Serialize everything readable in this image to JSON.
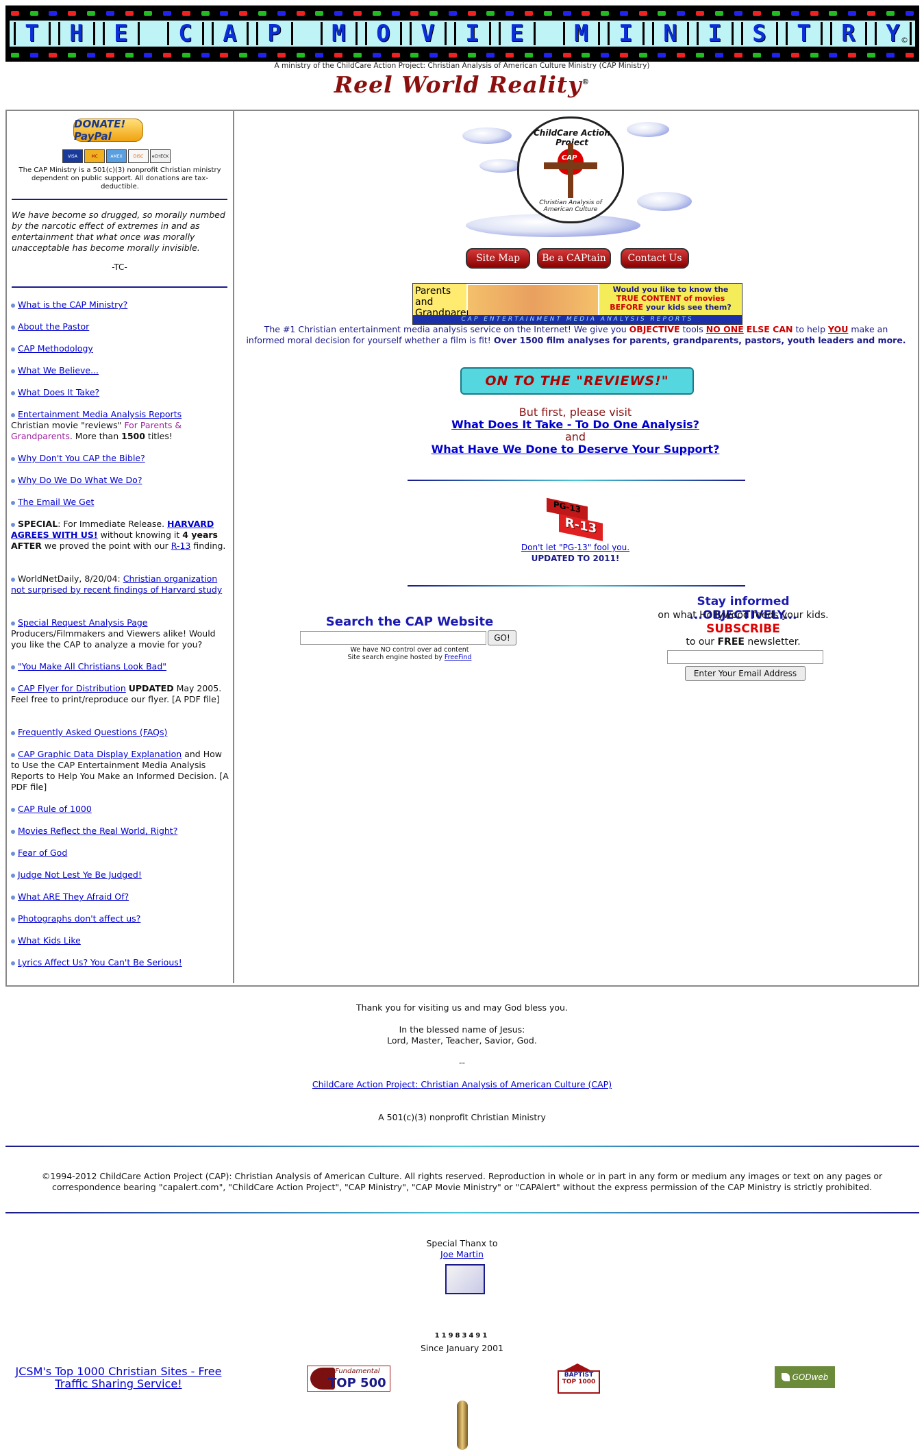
{
  "header": {
    "banner_letters": [
      "T",
      "H",
      "E",
      "",
      "C",
      "A",
      "P",
      "",
      "M",
      "O",
      "V",
      "I",
      "E",
      "",
      "M",
      "I",
      "N",
      "I",
      "S",
      "T",
      "R",
      "Y"
    ],
    "banner_mark": "©",
    "ministry_line": "A ministry of the ChildCare Action Project: Christian Analysis of American Culture Ministry (CAP Ministry)",
    "reel_title": "Reel World Reality",
    "reel_mark": "®"
  },
  "sidebar": {
    "donate_label": "DONATE! PayPal",
    "cards": [
      "VISA",
      "MC",
      "AMEX",
      "DISC",
      "eCHECK"
    ],
    "nonprofit_note": "The CAP Ministry is a 501(c)(3) nonprofit Christian ministry dependent on public support. All donations are tax-deductible.",
    "quote": "We have become so drugged, so morally numbed by the narcotic effect of extremes in and as entertainment that what once was morally unacceptable has become morally invisible.",
    "quote_attr": "-TC-",
    "links": {
      "what_is": "What is the CAP Ministry?",
      "about_pastor": "About the Pastor",
      "methodology": "CAP Methodology",
      "believe": "What We Believe...",
      "take": "What Does It Take?",
      "reports": "Entertainment Media Analysis Reports",
      "reports_desc_a": "Christian movie \"reviews\"",
      "reports_desc_b": "For Parents & Grandparents",
      "reports_desc_c": ". More than",
      "reports_desc_d": "1500",
      "reports_desc_e": "titles!",
      "bible": "Why Don't You CAP the Bible?",
      "why_do": "Why Do We Do What We Do?",
      "email": "The Email We Get",
      "special_label": "SPECIAL",
      "special_text_a": ": For Immediate Release.",
      "special_link": "HARVARD AGREES WITH US!",
      "special_text_b": "without knowing it",
      "special_years": "4 years AFTER",
      "special_text_c": "we proved the point with our",
      "special_link2": "R-13",
      "special_text_d": "finding.",
      "wnd_text": "WorldNetDaily, 8/20/04:",
      "wnd_link": "Christian organization not surprised by recent findings of Harvard study",
      "special_request": "Special Request Analysis Page",
      "special_request_desc": "Producers/Filmmakers and Viewers alike! Would you like the CAP to analyze a movie for you?",
      "look_bad": "\"You Make All Christians Look Bad\"",
      "flyer": "CAP Flyer for Distribution",
      "flyer_updated": "UPDATED",
      "flyer_desc": "May 2005. Feel free to print/reproduce our flyer. [A PDF file]",
      "faqs": "Frequently Asked Questions (FAQs)",
      "graphic": "CAP Graphic Data Display Explanation",
      "graphic_desc": "and How to Use the CAP Entertainment Media Analysis Reports to Help You Make an Informed Decision. [A PDF file]",
      "rule": "CAP Rule of 1000",
      "movies_reflect": "Movies Reflect the Real World, Right?",
      "fear": "Fear of God",
      "judge": "Judge Not Lest Ye Be Judged!",
      "afraid": "What ARE They Afraid Of?",
      "photographs": "Photographs don't affect us?",
      "kids_like": "What Kids Like",
      "lyrics": "Lyrics Affect Us? You Can't Be Serious!"
    }
  },
  "main": {
    "seal_top": "ChildCare Action Project",
    "seal_bottom": "Christian Analysis of American Culture",
    "seal_center": "CAP",
    "btn_sitemap": "Site Map",
    "btn_captain": "Be a CAPtain",
    "btn_contact": "Contact Us",
    "parents_left": "Parents and Grandparents!",
    "parents_right_a": "Would you like to know the",
    "parents_right_b": "TRUE CONTENT of movies",
    "parents_right_c": "BEFORE",
    "parents_right_d": "your kids see them?",
    "parents_strip": "CAP ENTERTAINMENT MEDIA ANALYSIS REPORTS",
    "intro_a": "The #1 Christian entertainment media analysis service on the Internet! We give you",
    "intro_objective": "OBJECTIVE",
    "intro_b": "tools",
    "intro_noone": "NO ONE",
    "intro_else": "ELSE CAN",
    "intro_c": "to help",
    "intro_you": "YOU",
    "intro_d": "make an informed moral decision for yourself whether a film is fit!",
    "intro_bold": "Over 1500 film analyses for parents, grandparents, pastors, youth leaders and more.",
    "reviews_btn": "ON TO THE \"REVIEWS!\"",
    "first_visit": "But first, please visit",
    "link_take_one": "What Does It Take - To Do One Analysis?",
    "and": "and",
    "link_deserve": "What Have We Done to Deserve Your Support?",
    "pg13_label": "PG-13",
    "r13_label": "R-13",
    "pg13_link": "Don't let \"PG-13\" fool you.",
    "pg13_updated": "UPDATED TO 2011!",
    "search_title": "Search the CAP Website",
    "search_go": "GO!",
    "search_note_a": "We have NO control over ad content",
    "search_note_b": "Site search engine hosted by",
    "search_note_link": "FreeFind",
    "news_title": "Stay informed ...OBJECTIVELY...",
    "news_sub": "on what Hollywood feeds your kids.",
    "news_subscribe": "SUBSCRIBE",
    "news_to_our": "to our",
    "news_free": "FREE",
    "news_newsletter": "newsletter.",
    "news_btn": "Enter Your Email Address"
  },
  "footer": {
    "thanks": "Thank you for visiting us and may God bless you.",
    "blessed_a": "In the blessed name of Jesus:",
    "blessed_b": "Lord, Master, Teacher, Savior, God.",
    "dashes": "--",
    "cap_link": "ChildCare Action Project: Christian Analysis of American Culture (CAP)",
    "nonprofit": "A 501(c)(3) nonprofit Christian Ministry",
    "copyright": "©1994-2012 ChildCare Action Project (CAP): Christian Analysis of American Culture. All rights reserved. Reproduction in whole or in part in any form or medium any images or text on any pages or correspondence bearing \"capalert.com\", \"ChildCare Action Project\", \"CAP Ministry\", \"CAP Movie Ministry\" or \"CAPAlert\" without the express permission of the CAP Ministry is strictly prohibited.",
    "special_thanx": "Special Thanx to",
    "joe_martin": "Joe Martin",
    "counter": "11983491",
    "since": "Since January 2001",
    "jcsm": "JCSM's Top 1000 Christian Sites - Free Traffic Sharing Service!",
    "fundamental_a": "Fundamental",
    "fundamental_b": "TOP 500",
    "baptist_a": "BAPTIST",
    "baptist_b": "TOP 1000",
    "godweb": "GODweb"
  },
  "colors": {
    "link": "#0000cc",
    "accent_red": "#cc0000",
    "title_red": "#8b0f0f",
    "banner_bg": "#bff4f7",
    "banner_letter": "#0a2fd6"
  }
}
